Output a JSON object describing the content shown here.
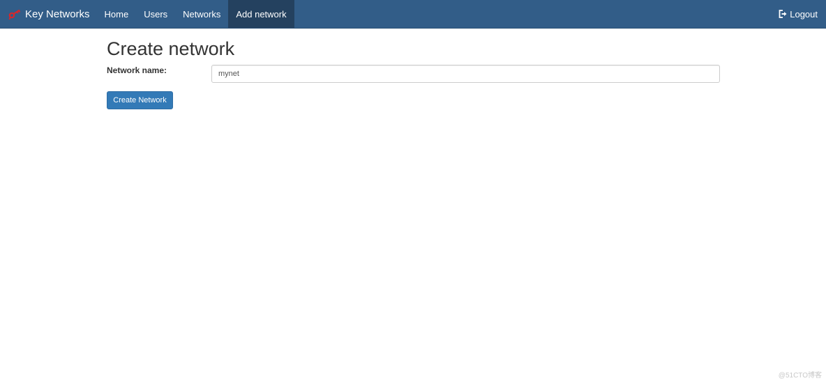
{
  "navbar": {
    "brand": "Key Networks",
    "brand_icon": "key-networks-logo-icon",
    "items": [
      {
        "label": "Home"
      },
      {
        "label": "Users"
      },
      {
        "label": "Networks"
      },
      {
        "label": "Add network",
        "active": true
      }
    ],
    "logout_label": "Logout",
    "logout_icon": "logout-icon"
  },
  "main": {
    "title": "Create network",
    "form": {
      "name_label": "Network name:",
      "name_value": "mynet"
    },
    "submit_label": "Create Network"
  },
  "watermark": "@51CTO博客",
  "colors": {
    "navbar": "#325d88",
    "navbar_active": "#24415f",
    "primary_button": "#337ab7",
    "logo_red": "#d9262a"
  }
}
